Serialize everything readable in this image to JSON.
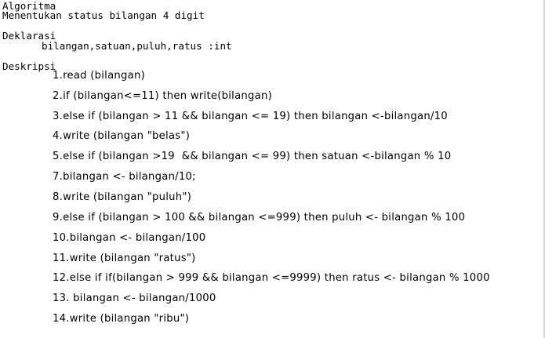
{
  "header": {
    "title": "Algoritma",
    "subtitle": "Menentukan status bilangan 4 digit"
  },
  "deklarasi": {
    "label": "Deklarasi",
    "content": "bilangan,satuan,puluh,ratus :int"
  },
  "deskripsi": {
    "label": "Deskripsi",
    "steps": [
      "1.read (bilangan)",
      "2.if (bilangan<=11) then write(bilangan)",
      "3.else if (bilangan > 11 && bilangan <= 19) then bilangan <-bilangan/10",
      "4.write (bilangan \"belas\")",
      "5.else if (bilangan >19  && bilangan <= 99) then satuan <-bilangan % 10",
      "7.bilangan <- bilangan/10;",
      "8.write (bilangan \"puluh\")",
      "9.else if (bilangan > 100 && bilangan <=999) then puluh <- bilangan % 100",
      "10.bilangan <- bilangan/100",
      "11.write (bilangan \"ratus\")",
      "12.else if if(bilangan > 999 && bilangan <=9999) then ratus <- bilangan % 1000",
      "13. bilangan <- bilangan/1000",
      "14.write (bilangan \"ribu\")"
    ]
  }
}
